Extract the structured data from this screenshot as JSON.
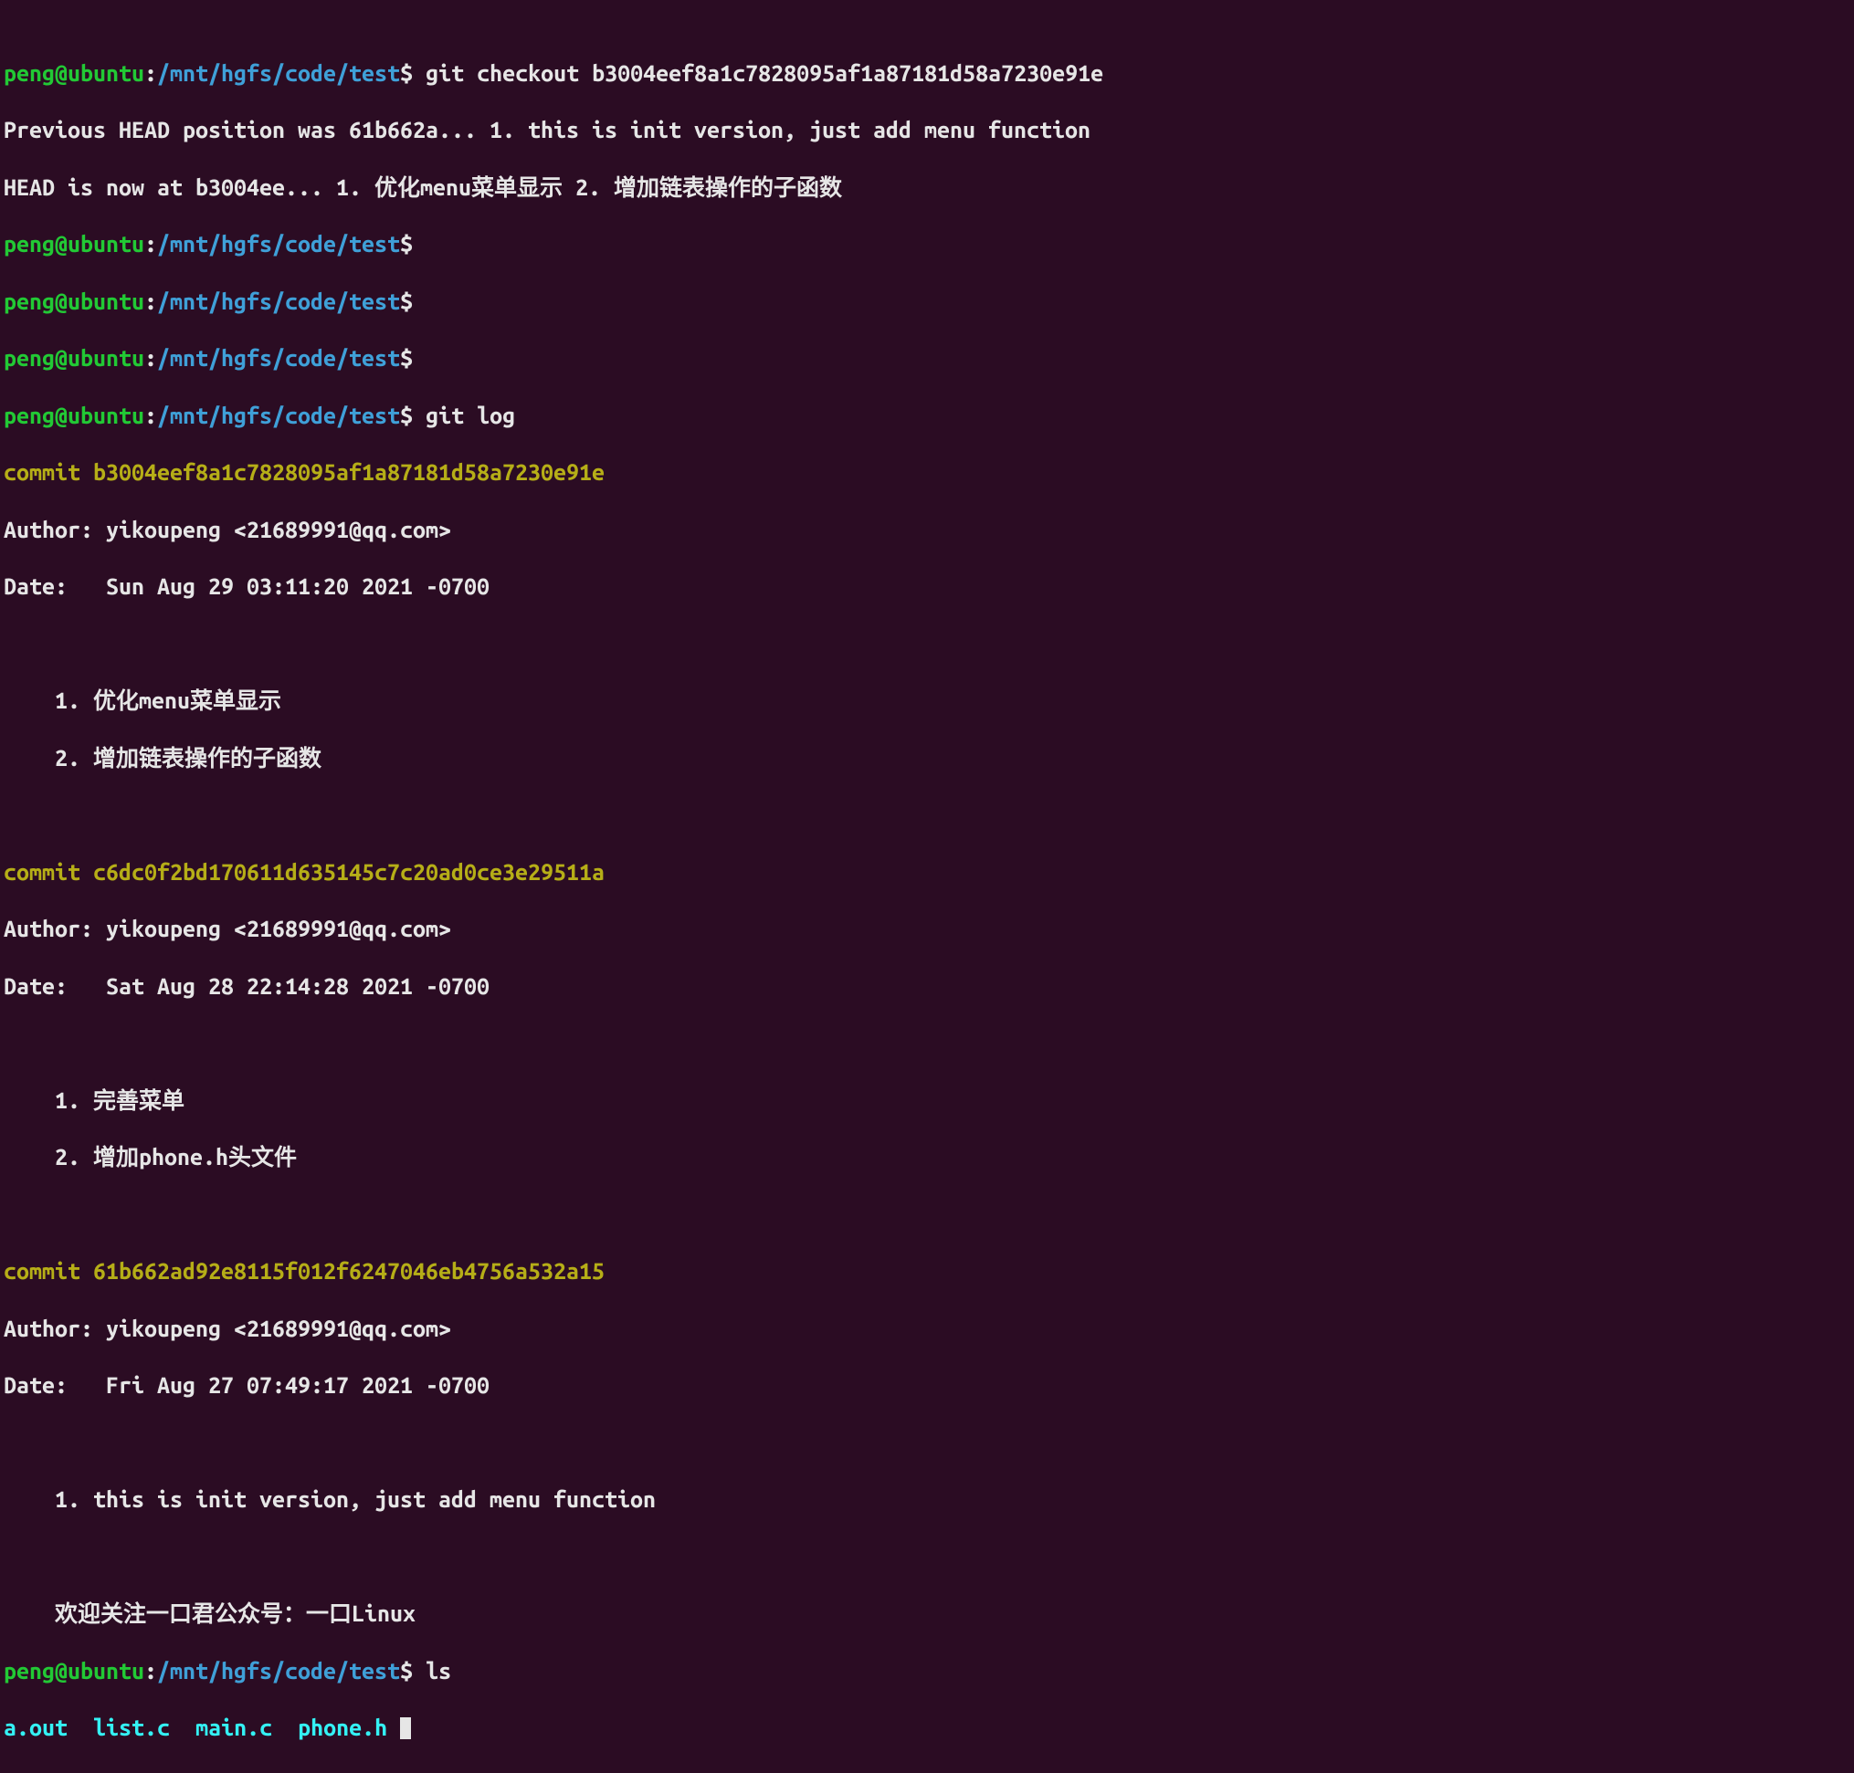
{
  "prompt": {
    "user": "peng@ubuntu",
    "sep": ":",
    "path": "/mnt/hgfs/code/test",
    "dollar": "$"
  },
  "cmds": {
    "checkout": "git checkout b3004eef8a1c7828095af1a87181d58a7230e91e",
    "gitlog": "git log",
    "ls": "ls"
  },
  "out": {
    "prev_head": "Previous HEAD position was 61b662a... 1. this is init version, just add menu function",
    "head_now": "HEAD is now at b3004ee... 1. 优化menu菜单显示 2. 增加链表操作的子函数"
  },
  "log": {
    "c1": {
      "commit": "commit b3004eef8a1c7828095af1a87181d58a7230e91e",
      "author": "Author: yikoupeng <21689991@qq.com>",
      "date": "Date:   Sun Aug 29 03:11:20 2021 -0700",
      "m1": "    1. 优化menu菜单显示",
      "m2": "    2. 增加链表操作的子函数"
    },
    "c2": {
      "commit": "commit c6dc0f2bd170611d635145c7c20ad0ce3e29511a",
      "author": "Author: yikoupeng <21689991@qq.com>",
      "date": "Date:   Sat Aug 28 22:14:28 2021 -0700",
      "m1": "    1. 完善菜单",
      "m2": "    2. 增加phone.h头文件"
    },
    "c3": {
      "commit": "commit 61b662ad92e8115f012f6247046eb4756a532a15",
      "author": "Author: yikoupeng <21689991@qq.com>",
      "date": "Date:   Fri Aug 27 07:49:17 2021 -0700",
      "m1": "    1. this is init version, just add menu function",
      "m2": "    欢迎关注一口君公众号：一口Linux"
    }
  },
  "ls": {
    "f1": "a.out",
    "f2": "list.c",
    "f3": "main.c",
    "f4": "phone.h"
  }
}
